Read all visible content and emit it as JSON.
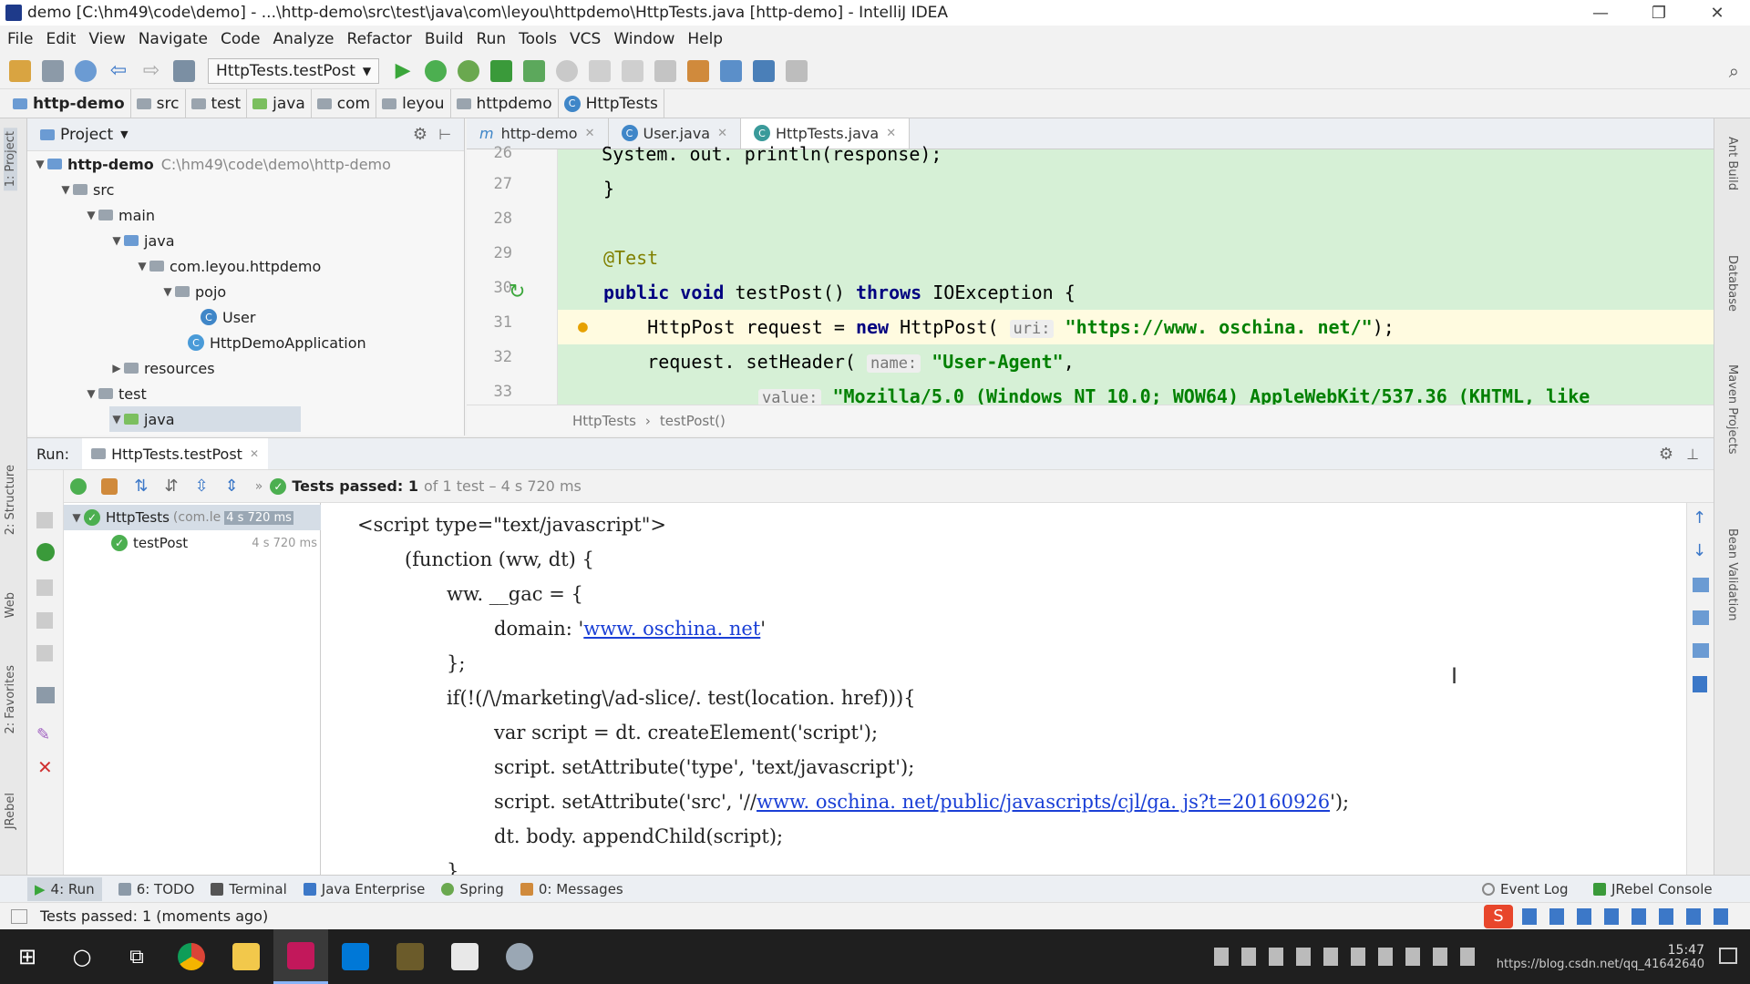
{
  "window": {
    "title": "demo [C:\\hm49\\code\\demo] - ...\\http-demo\\src\\test\\java\\com\\leyou\\httpdemo\\HttpTests.java [http-demo] - IntelliJ IDEA",
    "minimize": "—",
    "restore": "❐",
    "close": "✕"
  },
  "menu": [
    "File",
    "Edit",
    "View",
    "Navigate",
    "Code",
    "Analyze",
    "Refactor",
    "Build",
    "Run",
    "Tools",
    "VCS",
    "Window",
    "Help"
  ],
  "toolbar": {
    "run_config": "HttpTests.testPost"
  },
  "navbar": [
    "http-demo",
    "src",
    "test",
    "java",
    "com",
    "leyou",
    "httpdemo",
    "HttpTests"
  ],
  "project": {
    "header": "Project",
    "root_label": "http-demo",
    "root_path": "C:\\hm49\\code\\demo\\http-demo",
    "nodes": [
      "src",
      "main",
      "java",
      "com.leyou.httpdemo",
      "pojo",
      "User",
      "HttpDemoApplication",
      "resources",
      "test",
      "java"
    ]
  },
  "editor": {
    "tabs": [
      "http-demo",
      "User.java",
      "HttpTests.java"
    ],
    "line_numbers": [
      "26",
      "27",
      "28",
      "29",
      "30",
      "31",
      "32",
      "33"
    ],
    "lines": {
      "l26": "    System. out. println(response);",
      "l27": "}",
      "l29_ann": "@Test",
      "l30_kw1": "public void",
      "l30_mid": " testPost() ",
      "l30_kw2": "throws",
      "l30_tail": " IOException {",
      "l31_a": "    HttpPost request = ",
      "l31_kw": "new",
      "l31_b": " HttpPost( ",
      "l31_hint": "uri:",
      "l31_str": " \"https://www. oschina. net/\"",
      "l31_c": ");",
      "l32_a": "    request. setHeader( ",
      "l32_hint": "name:",
      "l32_str": " \"User-Agent\"",
      "l32_c": ",",
      "l33_hint": "value:",
      "l33_str": " \"Mozilla/5.0 (Windows NT 10.0; WOW64) AppleWebKit/537.36 (KHTML, like"
    },
    "breadcrumb": [
      "HttpTests",
      "testPost()"
    ]
  },
  "run": {
    "label": "Run:",
    "tab": "HttpTests.testPost",
    "status_bold": "Tests passed: 1",
    "status_rest": "of 1 test – 4 s 720 ms",
    "tree": [
      {
        "name": "HttpTests",
        "detail": "(com.le",
        "time": "4 s 720 ms"
      },
      {
        "name": "testPost",
        "detail": "",
        "time": "4 s 720 ms"
      }
    ],
    "console": {
      "c1": "<script type=\"text/javascript\">",
      "c2": "(function (ww, dt) {",
      "c3": "ww. __gac = {",
      "c4a": "domain: '",
      "c4link": "www. oschina. net",
      "c4b": "'",
      "c5": "};",
      "c6": "if(!(/\\/marketing\\/ad-slice/. test(location. href))){",
      "c7": "var script = dt. createElement('script');",
      "c8": "script. setAttribute('type', 'text/javascript');",
      "c9a": "script. setAttribute('src', '//",
      "c9link": "www. oschina. net/public/javascripts/cjl/ga. js?t=20160926",
      "c9b": "');",
      "c10": "dt. body. appendChild(script);",
      "c11": "}"
    }
  },
  "toolwindows": [
    "4: Run",
    "6: TODO",
    "Terminal",
    "Java Enterprise",
    "Spring",
    "0: Messages"
  ],
  "toolwindows_right": [
    "Event Log",
    "JRebel Console"
  ],
  "status": "Tests passed: 1 (moments ago)",
  "left_stripe": [
    "1: Project",
    "2: Structure",
    "Web",
    "2: Favorites",
    "JRebel"
  ],
  "right_stripe": [
    "Ant Build",
    "Database",
    "Maven Projects",
    "Bean Validation"
  ],
  "taskbar": {
    "time": "15:47",
    "url": "https://blog.csdn.net/qq_41642640"
  }
}
